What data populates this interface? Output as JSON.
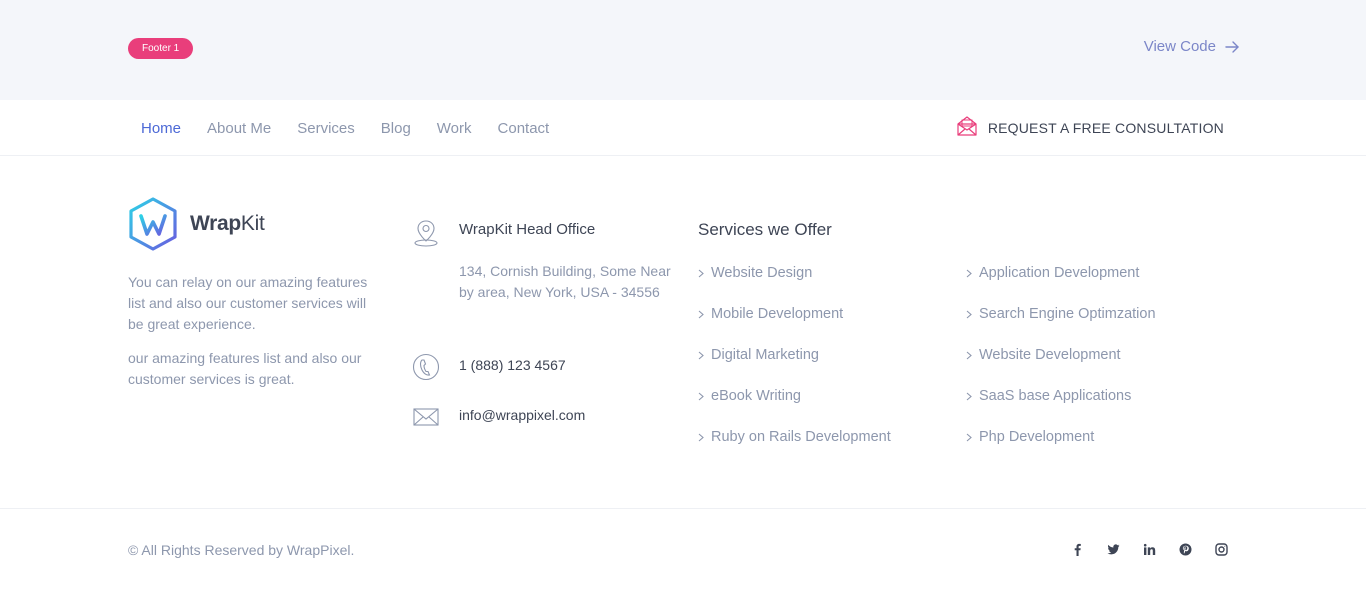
{
  "banner": {
    "badge": "Footer 1",
    "view_code": "View Code"
  },
  "nav": {
    "items": [
      {
        "label": "Home",
        "active": true
      },
      {
        "label": "About Me"
      },
      {
        "label": "Services"
      },
      {
        "label": "Blog"
      },
      {
        "label": "Work"
      },
      {
        "label": "Contact"
      }
    ],
    "cta": "REQUEST A FREE CONSULTATION"
  },
  "brand": {
    "logo_bold": "Wrap",
    "logo_rest": "Kit",
    "para1": "You can relay on our amazing features list and also our customer services will be great experience.",
    "para2": "our amazing features list and also our customer services is great."
  },
  "contact": {
    "office_title": "WrapKit Head Office",
    "address": "134, Cornish Building, Some Near by area, New York, USA - 34556",
    "phone": "1 (888) 123 4567",
    "email": "info@wrappixel.com"
  },
  "services": {
    "title": "Services we Offer",
    "col1": [
      "Website Design",
      "Mobile Development",
      "Digital Marketing",
      "eBook Writing",
      "Ruby on Rails Development"
    ],
    "col2": [
      "Application Development",
      "Search Engine Optimzation",
      "Website Development",
      "SaaS base Applications",
      "Php Development"
    ]
  },
  "bottom": {
    "copyright": "© All Rights Reserved by WrapPixel.",
    "social": [
      "facebook-icon",
      "twitter-icon",
      "linkedin-icon",
      "pinterest-icon",
      "instagram-icon"
    ]
  },
  "colors": {
    "accent": "#4c69d6",
    "badge": "#e93e7b",
    "heading": "#3e4555",
    "muted": "#8d97ad",
    "banner_bg": "#f4f6fa"
  }
}
